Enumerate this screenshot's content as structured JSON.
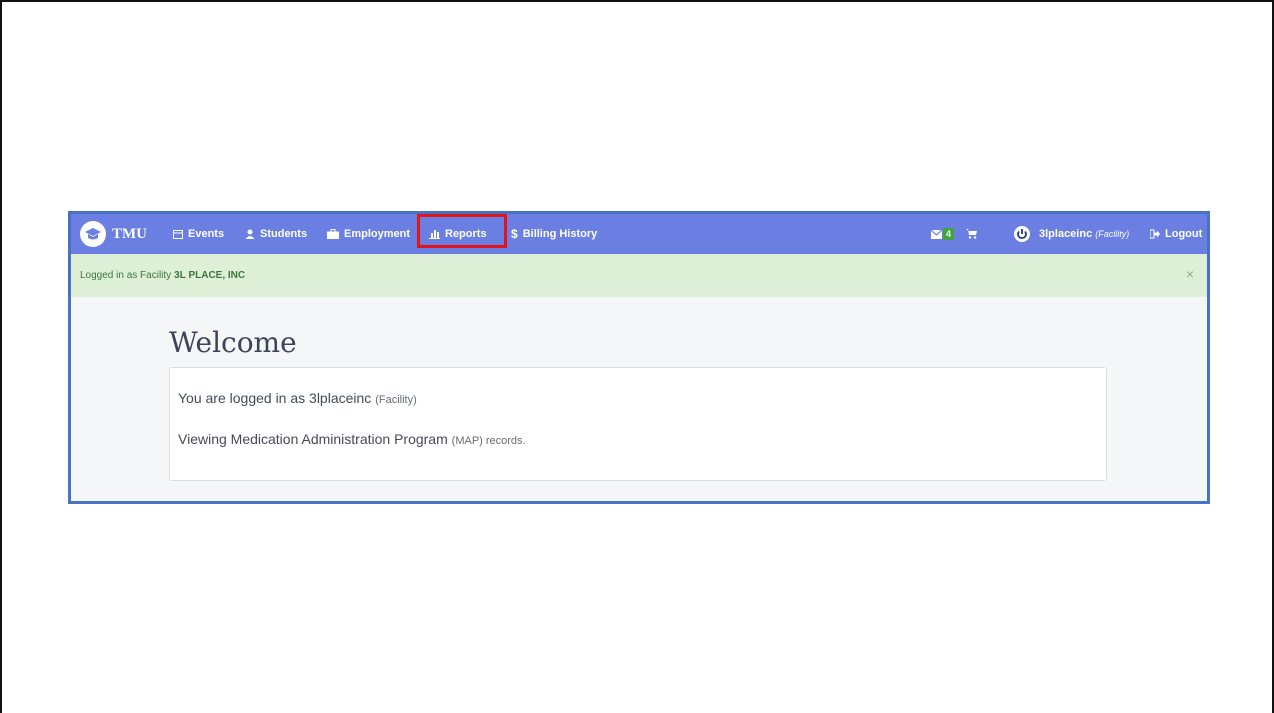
{
  "navbar": {
    "brand": "TMU",
    "items": [
      {
        "label": "Events",
        "icon": "calendar-icon"
      },
      {
        "label": "Students",
        "icon": "user-icon"
      },
      {
        "label": "Employment",
        "icon": "briefcase-icon"
      },
      {
        "label": "Reports",
        "icon": "bar-chart-icon"
      },
      {
        "label": "Billing History",
        "icon": "dollar-icon"
      }
    ],
    "messages_badge": "4",
    "username": "3lplaceinc",
    "user_role": "(Facility)",
    "logout": "Logout"
  },
  "alert": {
    "prefix": "Logged in as Facility",
    "facility_name": "3L PLACE, INC",
    "close": "×"
  },
  "welcome": {
    "title": "Welcome",
    "line1_main": "You are logged in as 3lplaceinc",
    "line1_muted": "(Facility)",
    "line2_main": "Viewing Medication Administration Program",
    "line2_muted": "(MAP) records."
  },
  "colors": {
    "navbar": "#6b7fe3",
    "highlight": "#e0161b",
    "alert_bg": "#dff0d8",
    "alert_text": "#3c763d",
    "badge": "#3fa53d"
  }
}
